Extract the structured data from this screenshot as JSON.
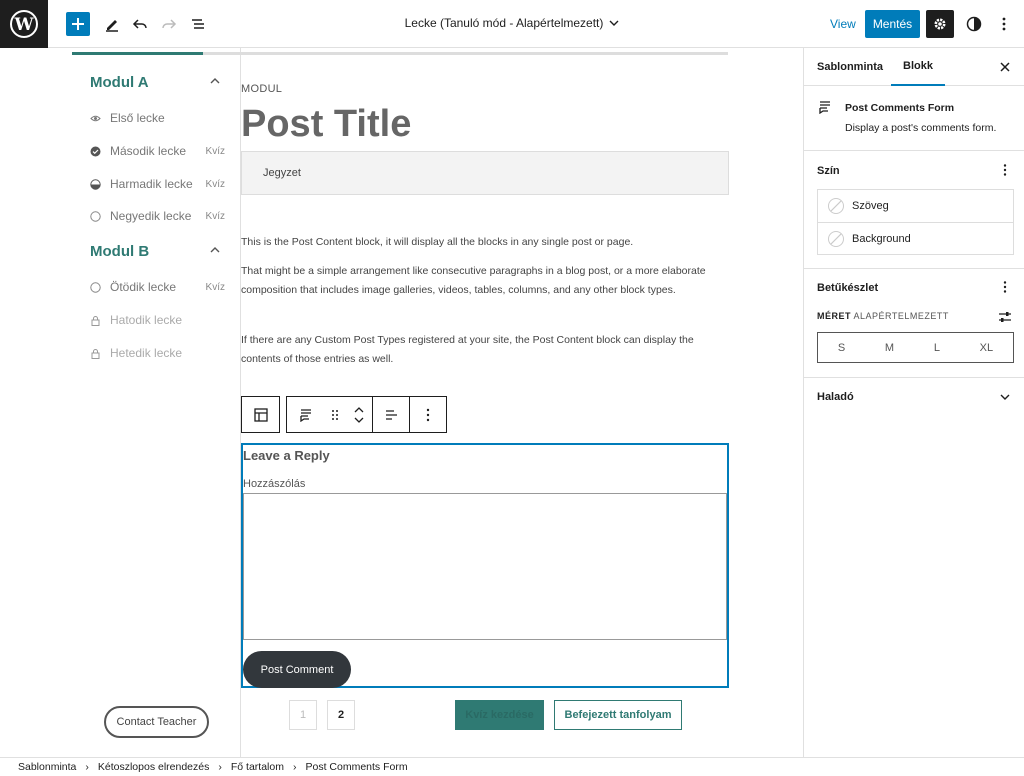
{
  "topbar": {
    "document_title": "Lecke (Tanuló mód - Alapértelmezett)",
    "view_label": "View",
    "save_label": "Mentés"
  },
  "course": {
    "modules": [
      {
        "title": "Modul A",
        "lessons": [
          {
            "name": "Első lecke",
            "quiz": "",
            "status": "eye"
          },
          {
            "name": "Második lecke",
            "quiz": "Kvíz",
            "status": "completed"
          },
          {
            "name": "Harmadik lecke",
            "quiz": "Kvíz",
            "status": "in-progress"
          },
          {
            "name": "Negyedik lecke",
            "quiz": "Kvíz",
            "status": "not-started"
          }
        ]
      },
      {
        "title": "Modul B",
        "lessons": [
          {
            "name": "Ötödik lecke",
            "quiz": "Kvíz",
            "status": "not-started"
          },
          {
            "name": "Hatodik lecke",
            "quiz": "",
            "status": "locked"
          },
          {
            "name": "Hetedik lecke",
            "quiz": "",
            "status": "locked"
          }
        ]
      }
    ],
    "contact_label": "Contact Teacher"
  },
  "main": {
    "modul_label": "MODUL",
    "post_title": "Post Title",
    "note_label": "Jegyzet",
    "paragraphs": [
      "This is the Post Content block, it will display all the blocks in any single post or page.",
      "That might be a simple arrangement like consecutive paragraphs in a blog post, or a more elaborate composition that includes image galleries, videos, tables, columns, and any other block types.",
      "If there are any Custom Post Types registered at your site, the Post Content block can display the contents of those entries as well."
    ],
    "comment_form": {
      "reply_title": "Leave a Reply",
      "comment_label": "Hozzászólás",
      "submit_label": "Post Comment"
    },
    "pagination": [
      "1",
      "2"
    ],
    "quiz_start_label": "Kvíz kezdése",
    "complete_label": "Befejezett tanfolyam"
  },
  "settings": {
    "tab_template": "Sablonminta",
    "tab_block": "Blokk",
    "block_name": "Post Comments Form",
    "block_description": "Display a post's comments form.",
    "color_heading": "Szín",
    "color_items": [
      "Szöveg",
      "Background"
    ],
    "typography_heading": "Betűkészlet",
    "size_label": "MÉRET",
    "size_value": "ALAPÉRTELMEZETT",
    "sizes": [
      "S",
      "M",
      "L",
      "XL"
    ],
    "advanced_heading": "Haladó"
  },
  "breadcrumbs": [
    "Sablonminta",
    "Kétoszlopos elrendezés",
    "Fő tartalom",
    "Post Comments Form"
  ],
  "colors": {
    "accent": "#007cba",
    "teal": "#2f7a73",
    "dark": "#1e1e1e"
  },
  "course_progress_percent": 20
}
